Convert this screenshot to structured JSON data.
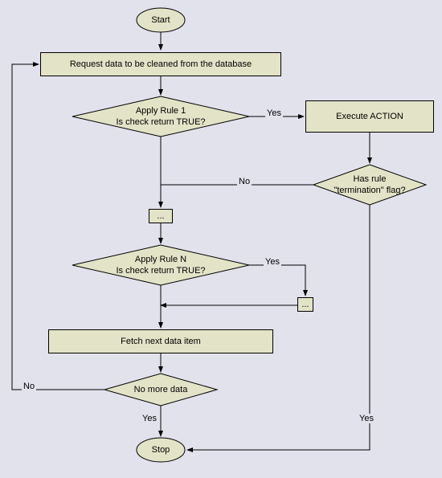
{
  "nodes": {
    "start": "Start",
    "request": "Request data to be cleaned from the database",
    "rule1_l1": "Apply Rule 1",
    "rule1_l2": "Is check return TRUE?",
    "execute": "Execute ACTION",
    "termination_l1": "Has rule",
    "termination_l2": "\"termination\" flag?",
    "dots1": "...",
    "ruleN_l1": "Apply Rule N",
    "ruleN_l2": "Is check return TRUE?",
    "dots2": "...",
    "fetch": "Fetch next data item",
    "nomore": "No more data",
    "stop": "Stop"
  },
  "labels": {
    "yes1": "Yes",
    "no1": "No",
    "yes2": "Yes",
    "no2": "No",
    "yes3": "Yes",
    "yes4": "Yes"
  }
}
